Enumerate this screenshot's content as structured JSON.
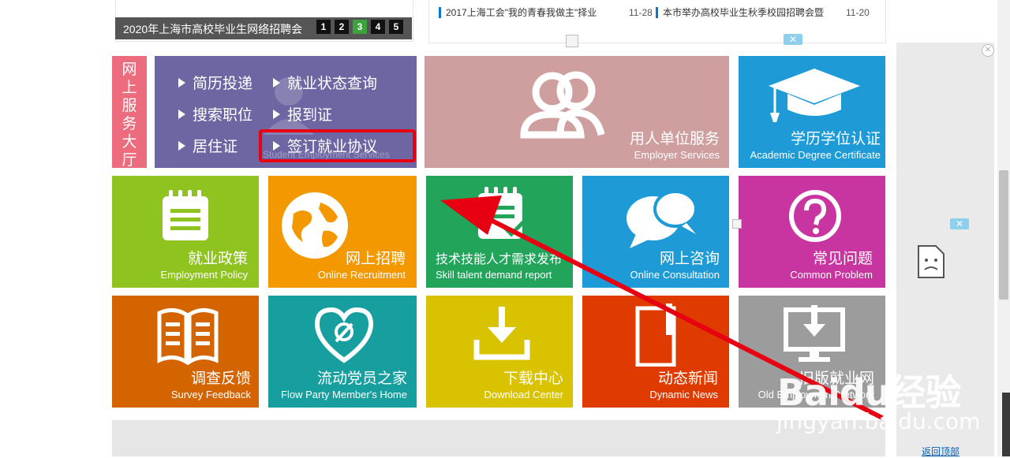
{
  "banner": {
    "title": "2020年上海市高校毕业生网络招聘会",
    "pages": [
      "1",
      "2",
      "3",
      "4",
      "5"
    ],
    "active_page": 2
  },
  "news": [
    {
      "title": "2017上海工会\"我的青春我做主\"择业",
      "date": "11-28"
    },
    {
      "title": "本市举办高校毕业生秋季校园招聘会暨",
      "date": "11-20"
    }
  ],
  "service_hall": {
    "label": "网上服务大厅",
    "links": [
      "简历投递",
      "就业状态查询",
      "搜索职位",
      "报到证",
      "居住证",
      "签订就业协议"
    ],
    "faded_en": "Student Employment Services"
  },
  "tiles": {
    "employer": {
      "cn": "用人单位服务",
      "en": "Employer Services",
      "color": "#cf9fa0"
    },
    "degree": {
      "cn": "学历学位认证",
      "en": "Academic Degree Certificate",
      "color": "#1e9bd7"
    },
    "policy": {
      "cn": "就业政策",
      "en": "Employment Policy",
      "color": "#8fc31f"
    },
    "recruit": {
      "cn": "网上招聘",
      "en": "Online Recruitment",
      "color": "#f39800"
    },
    "skill": {
      "cn": "技术技能人才需求发布",
      "en": "Skill talent demand report",
      "color": "#22a45a"
    },
    "consult": {
      "cn": "网上咨询",
      "en": "Online Consultation",
      "color": "#1e9bd7"
    },
    "faq": {
      "cn": "常见问题",
      "en": "Common Problem",
      "color": "#c935a0"
    },
    "survey": {
      "cn": "调查反馈",
      "en": "Survey Feedback",
      "color": "#d36400"
    },
    "party": {
      "cn": "流动党员之家",
      "en": "Flow Party Member's Home",
      "color": "#179f9f"
    },
    "download": {
      "cn": "下载中心",
      "en": "Download Center",
      "color": "#d9c200"
    },
    "news": {
      "cn": "动态新闻",
      "en": "Dynamic News",
      "color": "#df3b00"
    },
    "old": {
      "cn": "旧版就业网",
      "en": "Old Employment Network",
      "color": "#9c9c9c"
    }
  },
  "close_label": "✕",
  "back_to_top": "返回顶部",
  "watermark": {
    "brand": "Baidu经验",
    "url": "jingyan.baidu.com"
  }
}
